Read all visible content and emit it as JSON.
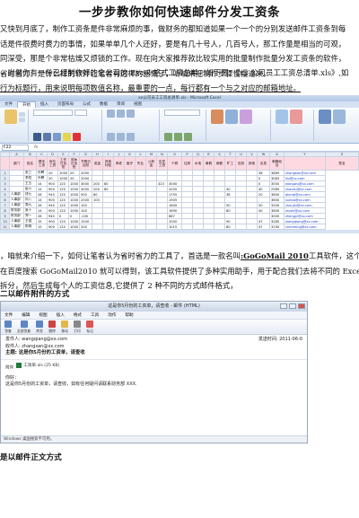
{
  "title": "一步步教你如何快速邮件分发工资条",
  "intro": [
    "又快到月底了，制作工资条是件非常麻烦的事，做财务的都知道如果一个一个的分别发送邮件工资条到每",
    "话是件很费时费力的事情，如果单单几个人还好，要是有几十号人，几百号人，那工作量是相当的可观，",
    "同深受，那是个非常枯燥又烦锁的工作。现在向大家推荐款比较实用的批量制作批量分发工资条的软件，",
    "省时省力。是什么样的软件让笔者有这样的感慨了，听咱来把制作步骤慢慢道来。"
  ],
  "para2": [
    "，当然你有一份已经制作好的全公司的 Excel 格式工资总单，如下图：《xx 公司员工工资总清单.xls》,如",
    "行为标题行，用来说明每项数值名称，最重要的一点，每行都有一个与之对应的邮箱地址。"
  ],
  "excel": {
    "window_title": "xx公司员工工资总清单.xls - Microsoft Excel",
    "tabs": [
      "文件",
      "开始",
      "插入",
      "页面布局",
      "公式",
      "数据",
      "审阅",
      "视图"
    ],
    "active_tab": "开始",
    "name_box": "F22",
    "fx": "fx",
    "col_letters": [
      "",
      "A",
      "B",
      "C",
      "D",
      "E",
      "F",
      "G",
      "H",
      "I",
      "J",
      "K",
      "L",
      "M",
      "N",
      "O",
      "P",
      "Q",
      "R",
      "S",
      "T",
      "U",
      "V",
      "W",
      "X",
      "Y",
      "Z"
    ],
    "headers": [
      "部门",
      "姓名",
      "基本工资",
      "岗位工资",
      "工作日加班",
      "双休日加班",
      "节假日加班",
      "奖金",
      "其他补贴",
      "养老",
      "医疗",
      "失业",
      "公积金",
      "应发工资",
      "个税",
      "住房",
      "水电",
      "事假",
      "病假",
      "旷工",
      "迟到",
      "其他",
      "实发",
      "邮箱地址",
      "",
      "签名"
    ],
    "rows": [
      [
        "1",
        "",
        "张三",
        "外聘",
        "20",
        "1000",
        "20",
        "2000",
        "",
        "",
        "",
        "",
        "",
        "",
        "",
        "",
        "",
        "",
        "",
        "",
        "",
        "",
        "",
        "36",
        "3669",
        "zhangsan@xx.com"
      ],
      [
        "2",
        "",
        "李四",
        "外聘",
        "20",
        "1000",
        "20",
        "2000",
        "",
        "",
        "",
        "",
        "",
        "",
        "",
        "",
        "",
        "",
        "",
        "",
        "",
        "",
        "",
        "0",
        "3083",
        "lisi@xx.com"
      ],
      [
        "3",
        "",
        "王五",
        "14",
        "900",
        "120",
        "1000",
        "3000",
        "200",
        "80",
        "",
        "",
        "",
        "",
        "323",
        "3000",
        "",
        "",
        "",
        "",
        "",
        "",
        "",
        "0",
        "3500",
        "wangwu@xx.com"
      ],
      [
        "4",
        "",
        "赵六",
        "14",
        "900",
        "120",
        "1000",
        "3000",
        "200",
        "80",
        "",
        "",
        "",
        "",
        "",
        "2020",
        "",
        "",
        "",
        "",
        "40",
        "",
        "",
        "40",
        "2589",
        "zhaoliu@xx.com"
      ],
      [
        "5",
        "人事部",
        "钱七",
        "26",
        "940",
        "120",
        "1000",
        "500",
        "80",
        "",
        "",
        "",
        "",
        "",
        "",
        "1755",
        "",
        "",
        "",
        "",
        "38",
        "",
        "",
        "20",
        "3600",
        "qianqi@xx.com"
      ],
      [
        "6",
        "人事部",
        "孙八",
        "14",
        "900",
        "120",
        "1000",
        "2000",
        "100",
        "",
        "",
        "",
        "",
        "",
        "",
        "1905",
        "",
        "",
        "",
        "",
        "",
        "",
        "",
        "",
        "3600",
        "sunba@xx.com"
      ],
      [
        "7",
        "人事部",
        "周九",
        "26",
        "940",
        "120",
        "1000",
        "100",
        "",
        "",
        "",
        "",
        "",
        "",
        "",
        "1800",
        "",
        "",
        "",
        "",
        "50",
        "",
        "",
        "30",
        "3200",
        "zhoujiu@xx.com"
      ],
      [
        "8",
        "财务部",
        "吴十",
        "14",
        "900",
        "120",
        "1000",
        "100",
        "",
        "",
        "",
        "",
        "",
        "",
        "",
        "1690",
        "",
        "",
        "",
        "",
        "80",
        "",
        "",
        "40",
        "3600",
        "wushi@xx.com"
      ],
      [
        "9",
        "财务部",
        "郑一",
        "26",
        "940",
        "0",
        "0",
        "-100",
        "",
        "",
        "",
        "",
        "",
        "",
        "",
        "887",
        "",
        "",
        "",
        "",
        "",
        "",
        "",
        "",
        "3000",
        "zhengyi@xx.com"
      ],
      [
        "10",
        "人事部",
        "王强",
        "15",
        "900",
        "120",
        "1000",
        "1500",
        "",
        "",
        "",
        "",
        "",
        "",
        "",
        "1000",
        "",
        "",
        "",
        "",
        "90",
        "",
        "",
        "47",
        "3285",
        "wangqiang@xx.com"
      ],
      [
        "11",
        "人事部",
        "陈明",
        "15",
        "900",
        "120",
        "1000",
        "200",
        "",
        "",
        "",
        "",
        "",
        "",
        "",
        "1015",
        "",
        "",
        "",
        "",
        "80",
        "",
        "",
        "47",
        "3190",
        "chenming@xx.com"
      ]
    ]
  },
  "para3": [
    "，咱就来介绍一下，如何让笔者认为省时省力的工具了，首选是一款名叫",
    "在百度搜索 GoGoMail2010 就可以得到，该工具软件提供了多种实用助手，用于配合我们去将不同的 Excel",
    "拆分，然后生成每个人的工资信息,它提供了 2 种不同的方式邮件格式，"
  ],
  "para3_tool": ":GoGoMail 2010",
  "para3_tail": "工具软件，这个",
  "heading1": "二以邮件附件的方式",
  "email": {
    "window_title": "这是你5月份的工资单，请查收 - 邮件 (HTML)",
    "menu": [
      "文件",
      "编辑",
      "视图",
      "插入",
      "格式",
      "工具",
      "动作",
      "帮助"
    ],
    "toolbar": [
      "答复",
      "全部答复",
      "转发",
      "删除",
      "移动",
      "打印",
      "标记"
    ],
    "from_label": "发件人:",
    "from": "wangqiang@xx.com",
    "sent_label": "发送时间:",
    "sent": "2011-06-0",
    "to_label": "收件人:",
    "to": "zhangsan@xx.com",
    "subject_label": "主题:",
    "subject": "这是你5月份的工资单，请查收",
    "attach_label": "附件:",
    "attach_file": "工资单.xls (25 KB)",
    "greeting": "你好：",
    "body": "这是你5月份的工资单，请查收，如有任何疑问请联系财务部 XXX.",
    "status": "Windows 桌面搜索不可用。"
  },
  "heading2": "是以邮件正文方式"
}
